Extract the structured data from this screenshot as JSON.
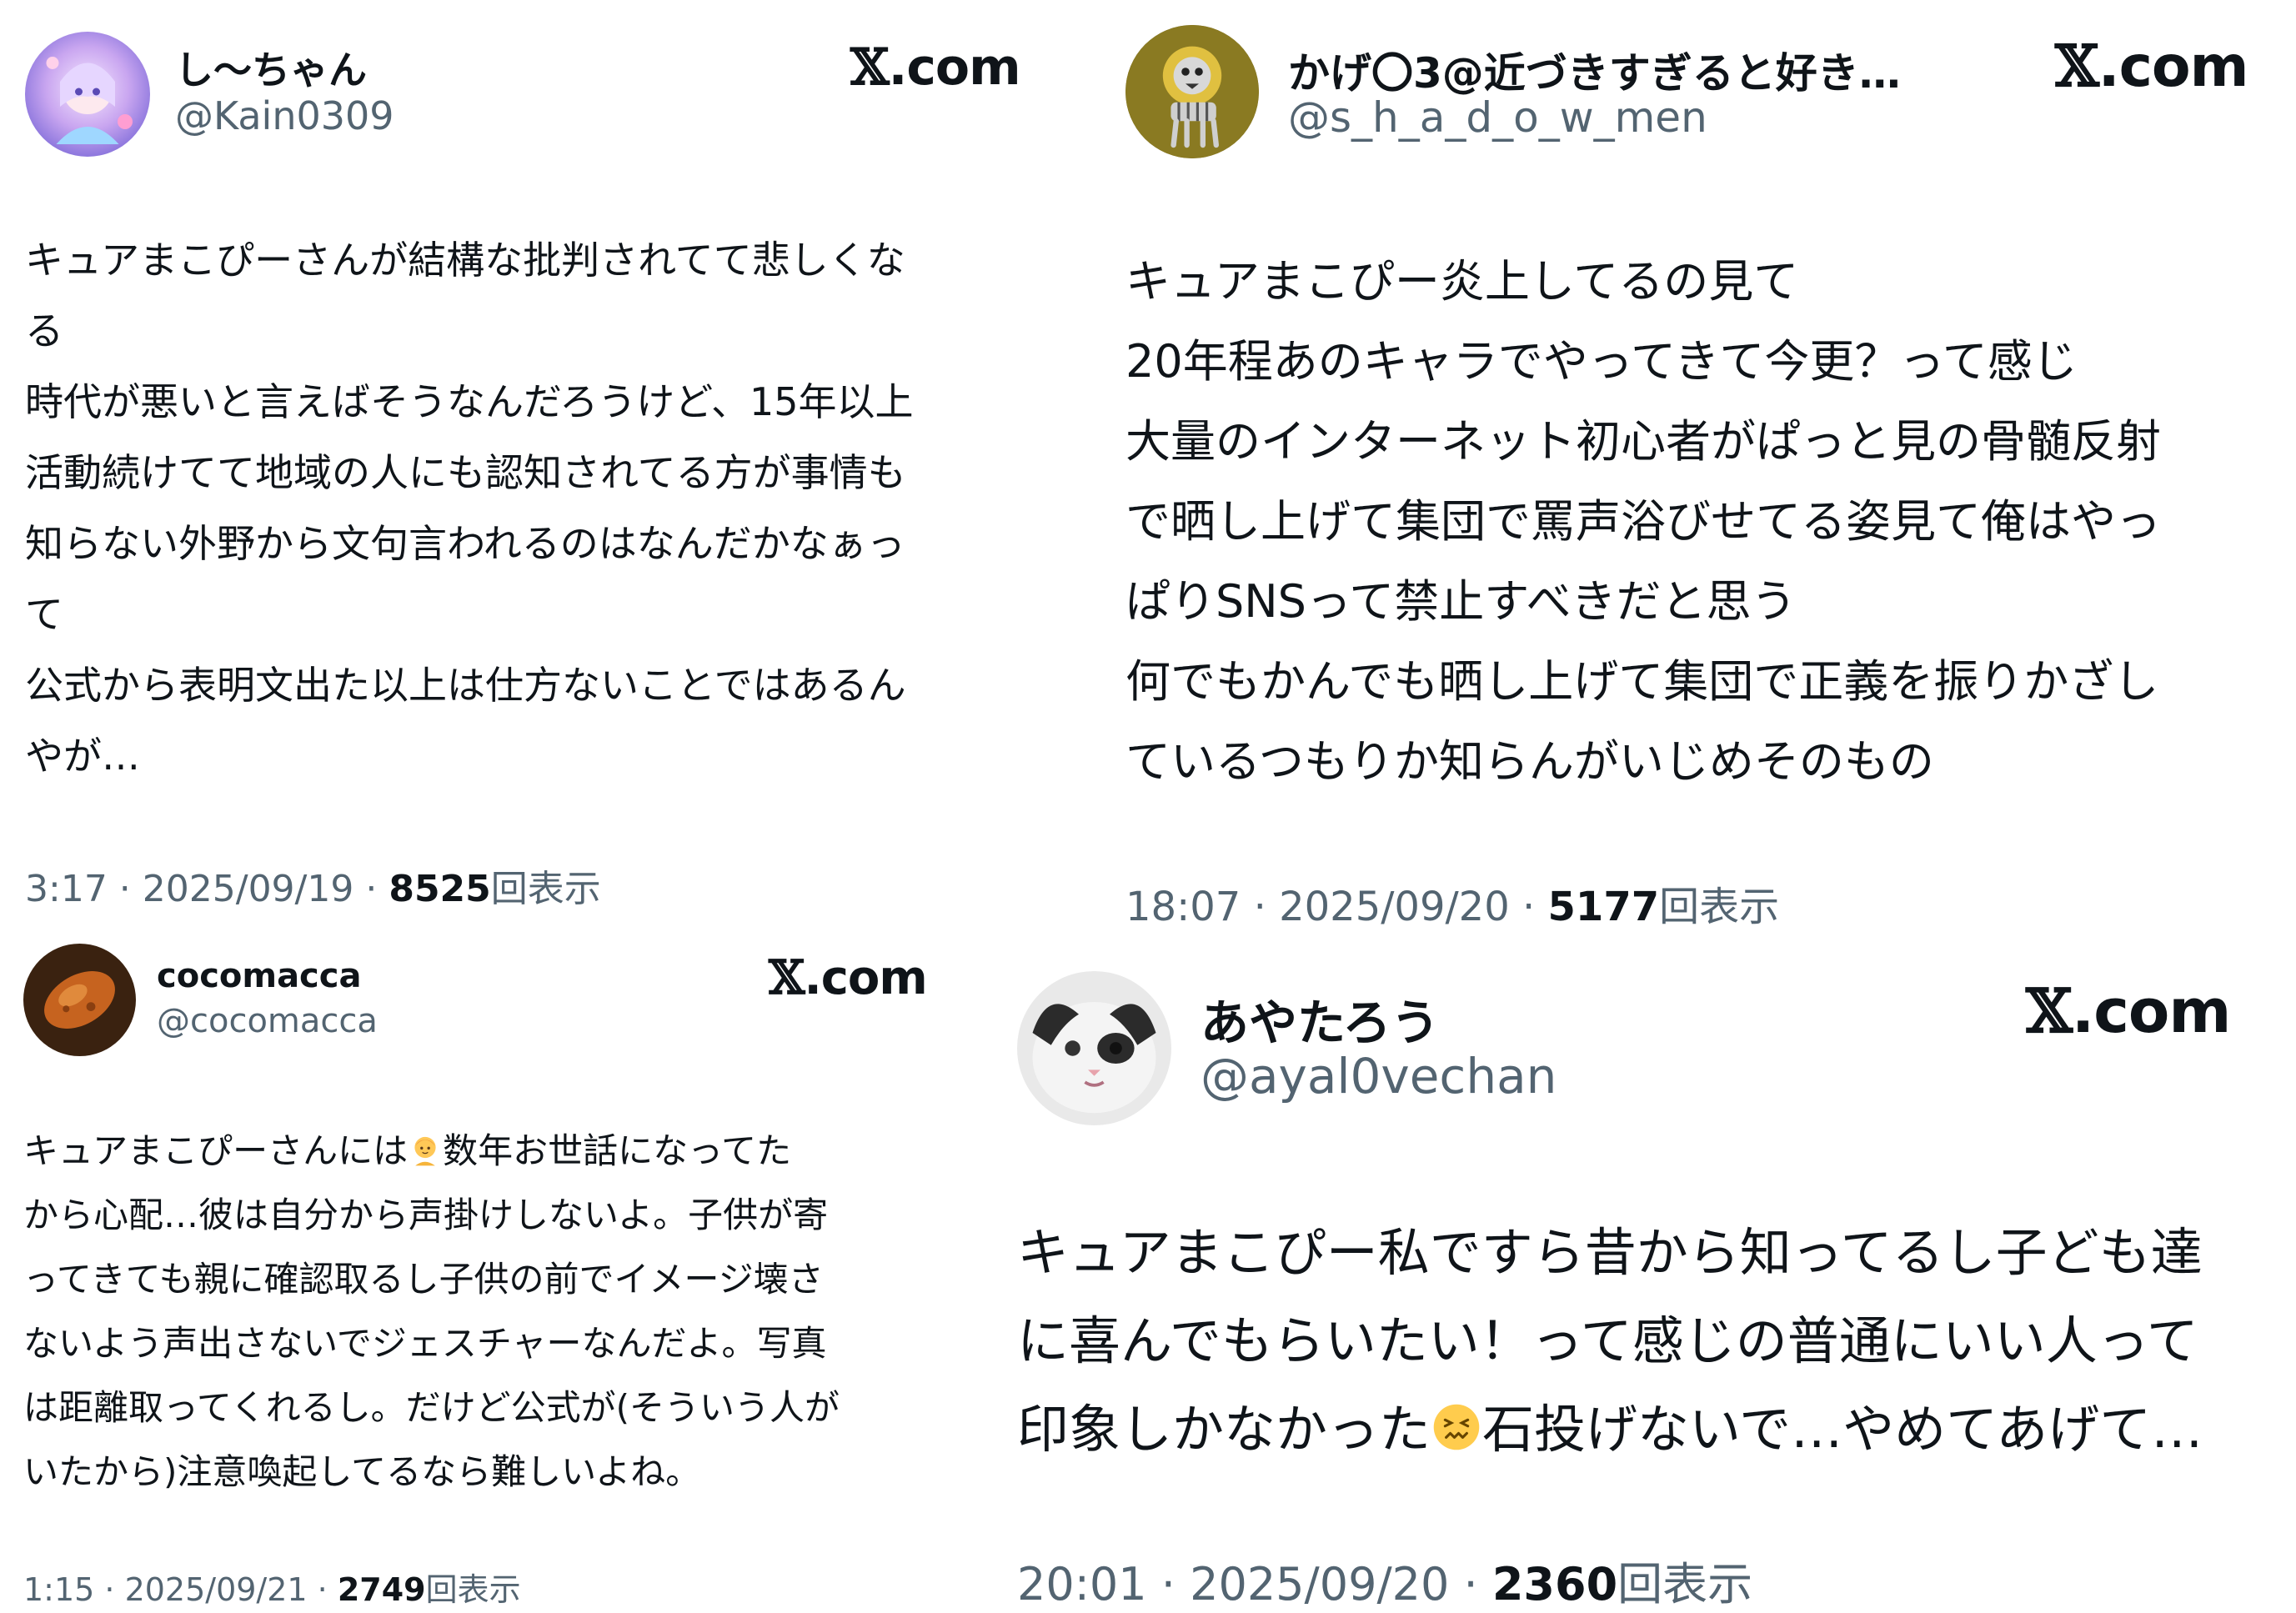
{
  "tweets": [
    {
      "display_name": "し〜ちゃん",
      "handle": "@Kain0309",
      "site_label": ".com",
      "avatar_icon": "pastel-anime-avatar-icon",
      "lines": [
        "キュアまこぴーさんが結構な批判されてて悲しくな",
        "る",
        "時代が悪いと言えばそうなんだろうけど、15年以上",
        "活動続けてて地域の人にも認知されてる方が事情も",
        "知らない外野から文句言われるのはなんだかなぁっ",
        "て",
        "公式から表明文出た以上は仕方ないことではあるん",
        "やが…"
      ],
      "timestamp": "3:17 · 2025/09/19 · ",
      "views": "8525",
      "views_suffix": "回表示"
    },
    {
      "display_name": "かげ〇3@近づきすぎると好き…",
      "handle": "@s_h_a_d_o_w_men",
      "site_label": ".com",
      "avatar_icon": "skeleton-lion-avatar-icon",
      "lines": [
        "キュアまこぴー炎上してるの見て",
        "20年程あのキャラでやってきて今更？って感じ",
        "大量のインターネット初心者がぱっと見の骨髄反射",
        "で晒し上げて集団で罵声浴びせてる姿見て俺はやっ",
        "ぱりSNSって禁止すべきだと思う",
        "何でもかんでも晒し上げて集団で正義を振りかざし",
        "ているつもりか知らんがいじめそのもの"
      ],
      "timestamp": "18:07 · 2025/09/20 · ",
      "views": "5177",
      "views_suffix": "回表示"
    },
    {
      "display_name": "cocomacca",
      "handle": "@cocomacca",
      "site_label": ".com",
      "avatar_icon": "orange-blob-avatar-icon",
      "lines": [
        {
          "before": "キュアまこぴーさんには",
          "emoji": "person-emoji-icon",
          "after": "数年お世話になってた"
        },
        {
          "before": "から心配…彼は自分から声掛けしないよ。子供が寄"
        },
        {
          "before": "ってきても親に確認取るし子供の前でイメージ壊さ"
        },
        {
          "before": "ないよう声出さないでジェスチャーなんだよ。写真"
        },
        {
          "before": "は距離取ってくれるし。だけど公式が(そういう人が"
        },
        {
          "before": "いたから)注意喚起してるなら難しいよね。"
        }
      ],
      "timestamp": "1:15 · 2025/09/21 · ",
      "views": "2749",
      "views_suffix": "回表示"
    },
    {
      "display_name": "あやたろう",
      "handle": "@ayal0vechan",
      "site_label": ".com",
      "avatar_icon": "cat-face-avatar-icon",
      "lines": [
        {
          "before": "キュアまこぴー私ですら昔から知ってるし子ども達"
        },
        {
          "before": "に喜んでもらいたい！って感じの普通にいい人って"
        },
        {
          "before": "印象しかなかった",
          "emoji": "confounded-face-emoji-icon",
          "after": "石投げないで…やめてあげて…"
        }
      ],
      "timestamp": "20:01 · 2025/09/20 · ",
      "views": "2360",
      "views_suffix": "回表示"
    }
  ]
}
